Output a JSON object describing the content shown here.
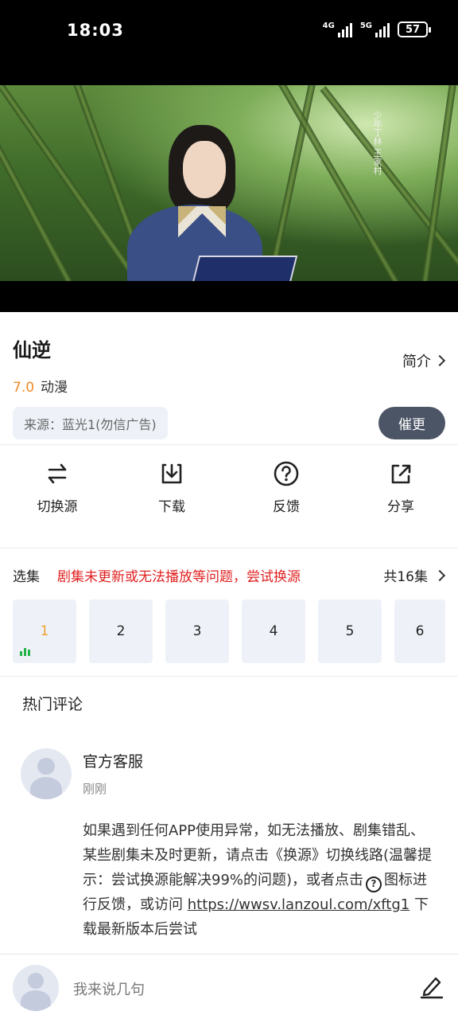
{
  "status_bar": {
    "time": "18:03",
    "signal_1_label": "4G",
    "signal_2_label": "5G",
    "battery": "57"
  },
  "video": {
    "calligraphy": "少年丁林 王家村"
  },
  "detail": {
    "title": "仙逆",
    "intro_label": "简介",
    "score": "7.0",
    "category": "动漫",
    "source": "来源：蓝光1(勿信广告)",
    "urge_button": "催更"
  },
  "actions": [
    {
      "label": "切换源",
      "icon": "swap-icon"
    },
    {
      "label": "下载",
      "icon": "download-icon"
    },
    {
      "label": "反馈",
      "icon": "help-icon"
    },
    {
      "label": "分享",
      "icon": "share-icon"
    }
  ],
  "episodes": {
    "section_title": "选集",
    "tip": "剧集未更新或无法播放等问题，尝试换源",
    "total": "共16集",
    "items": [
      "1",
      "2",
      "3",
      "4",
      "5",
      "6"
    ],
    "active_index": 0
  },
  "comments": {
    "section_title": "热门评论",
    "items": [
      {
        "author": "官方客服",
        "time": "刚刚",
        "text_part1": "如果遇到任何APP使用异常，如无法播放、剧集错乱、某些剧集未及时更新，请点击《换源》切换线路(温馨提示：尝试换源能解决99%的问题)，或者点击",
        "text_part2": "图标进行反馈，或访问",
        "link": "https://wwsv.lanzoul.com/xftg1",
        "text_part3": "下载最新版本后尝试"
      }
    ]
  },
  "composer": {
    "placeholder": "我来说几句"
  },
  "colors": {
    "accent_orange": "#f08a24",
    "tip_red": "#e02020",
    "urge_bg": "#4c5566",
    "tile_bg": "#eef2f8",
    "playing_green": "#24b24a"
  }
}
